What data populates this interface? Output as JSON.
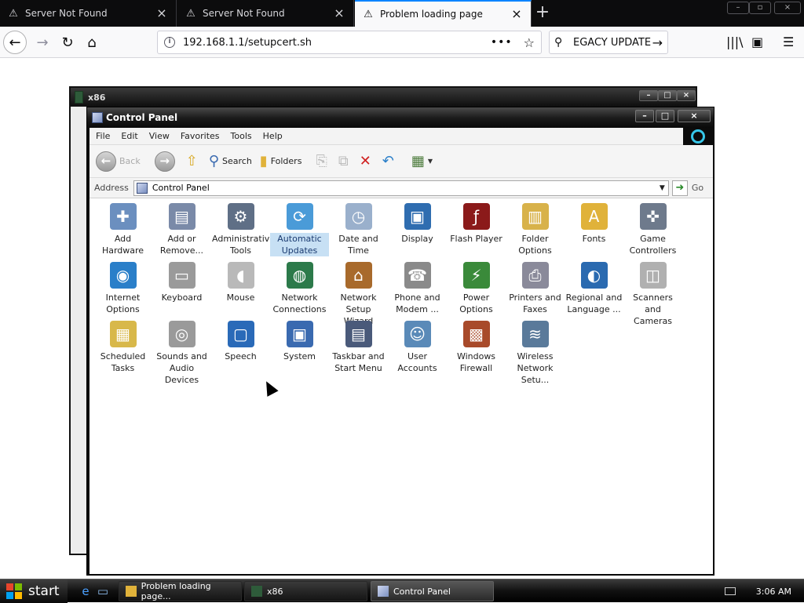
{
  "browser": {
    "tabs": [
      {
        "title": "Server Not Found",
        "active": false
      },
      {
        "title": "Server Not Found",
        "active": false
      },
      {
        "title": "Problem loading page",
        "active": true
      }
    ],
    "url": "192.168.1.1/setupcert.sh",
    "search_text": "EGACY UPDATE",
    "icons": {
      "back": "back-arrow-icon",
      "forward": "forward-arrow-icon",
      "reload": "reload-icon",
      "home": "home-icon",
      "library": "library-icon",
      "sidebar": "sidebar-icon",
      "menu": "hamburger-menu-icon"
    }
  },
  "back_window": {
    "title": "x86"
  },
  "control_panel": {
    "title": "Control Panel",
    "menu": [
      "File",
      "Edit",
      "View",
      "Favorites",
      "Tools",
      "Help"
    ],
    "toolbar": {
      "back": "Back",
      "search": "Search",
      "folders": "Folders"
    },
    "address_label": "Address",
    "address_value": "Control Panel",
    "go_label": "Go",
    "items": [
      {
        "label": "Add Hardware",
        "color": "#6b8fbf"
      },
      {
        "label": "Add or Remove...",
        "color": "#7a8aa8"
      },
      {
        "label": "Administrative Tools",
        "color": "#5f6f86"
      },
      {
        "label": "Automatic Updates",
        "color": "#4a9bd8",
        "selected": true
      },
      {
        "label": "Date and Time",
        "color": "#9ab0cc"
      },
      {
        "label": "Display",
        "color": "#2f6db0"
      },
      {
        "label": "Flash Player",
        "color": "#8b1a1a"
      },
      {
        "label": "Folder Options",
        "color": "#d8b24a"
      },
      {
        "label": "Fonts",
        "color": "#e0b23a"
      },
      {
        "label": "Game Controllers",
        "color": "#6e7a8c"
      },
      {
        "label": "Internet Options",
        "color": "#2a7fc9"
      },
      {
        "label": "Keyboard",
        "color": "#9a9a9a"
      },
      {
        "label": "Mouse",
        "color": "#b9b9b9"
      },
      {
        "label": "Network Connections",
        "color": "#2c7a4a"
      },
      {
        "label": "Network Setup Wizard",
        "color": "#a86a2c"
      },
      {
        "label": "Phone and Modem ...",
        "color": "#8a8a8a"
      },
      {
        "label": "Power Options",
        "color": "#3a8a3a"
      },
      {
        "label": "Printers and Faxes",
        "color": "#8a8a9a"
      },
      {
        "label": "Regional and Language ...",
        "color": "#2a6ab0"
      },
      {
        "label": "Scanners and Cameras",
        "color": "#b0b0b0"
      },
      {
        "label": "Scheduled Tasks",
        "color": "#d8b84a"
      },
      {
        "label": "Sounds and Audio Devices",
        "color": "#9a9a9a"
      },
      {
        "label": "Speech",
        "color": "#2a6ab8"
      },
      {
        "label": "System",
        "color": "#3a6ab0"
      },
      {
        "label": "Taskbar and Start Menu",
        "color": "#4a5a7a"
      },
      {
        "label": "User Accounts",
        "color": "#5a8ab8"
      },
      {
        "label": "Windows Firewall",
        "color": "#a84a2a"
      },
      {
        "label": "Wireless Network Setu...",
        "color": "#5a7a9a"
      }
    ]
  },
  "taskbar": {
    "start_label": "start",
    "tasks": [
      {
        "label": "Problem loading page...",
        "active": false
      },
      {
        "label": "x86",
        "active": false
      },
      {
        "label": "Control Panel",
        "active": true
      }
    ],
    "clock": "3:06 AM"
  }
}
